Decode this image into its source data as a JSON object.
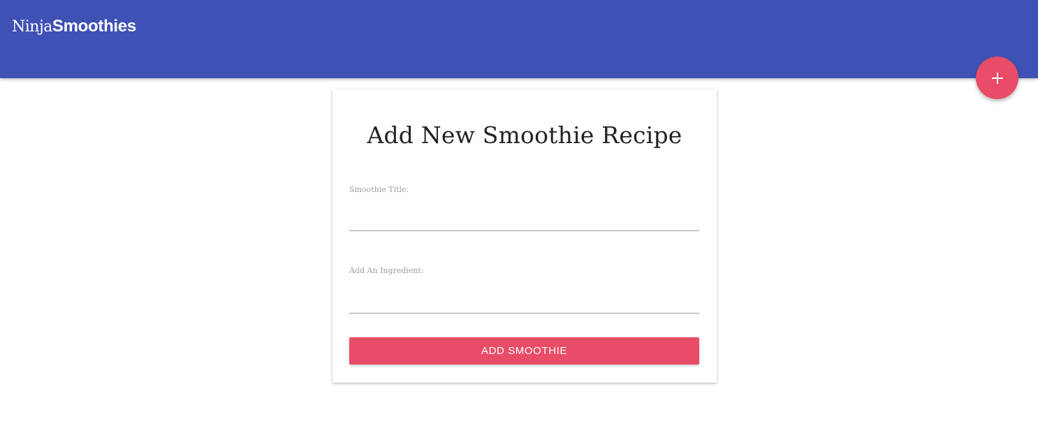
{
  "navbar": {
    "brand_light": "Ninja",
    "brand_bold": "Smoothies",
    "background_color": "#3f51b5"
  },
  "fab": {
    "icon": "add-icon",
    "label": "+",
    "color": "#e84c66"
  },
  "form": {
    "title": "Add New Smoothie Recipe",
    "title_field": {
      "label": "Smoothie Title:",
      "value": "",
      "placeholder": ""
    },
    "ingredient_field": {
      "label": "Add An Ingredient:",
      "value": "",
      "placeholder": ""
    },
    "submit_label": "ADD SMOOTHIE",
    "accent_color": "#e84c66"
  }
}
